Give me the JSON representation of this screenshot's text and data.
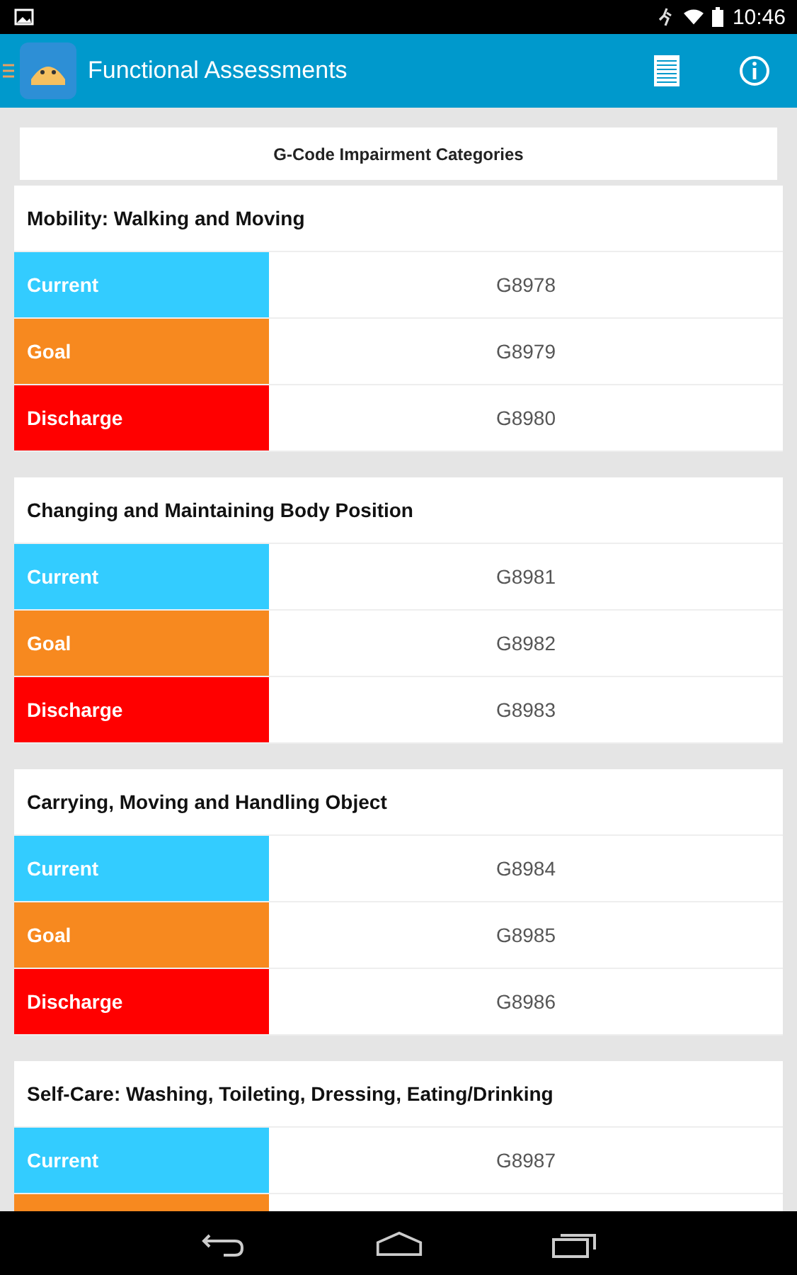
{
  "status_bar": {
    "time": "10:46"
  },
  "app_bar": {
    "title": "Functional Assessments"
  },
  "header": {
    "title": "G-Code Impairment Categories"
  },
  "categories": [
    {
      "title": "Mobility: Walking and Moving",
      "rows": [
        {
          "kind": "current",
          "label": "Current",
          "code": "G8978"
        },
        {
          "kind": "goal",
          "label": "Goal",
          "code": "G8979"
        },
        {
          "kind": "discharge",
          "label": "Discharge",
          "code": "G8980"
        }
      ]
    },
    {
      "title": "Changing and Maintaining Body Position",
      "rows": [
        {
          "kind": "current",
          "label": "Current",
          "code": "G8981"
        },
        {
          "kind": "goal",
          "label": "Goal",
          "code": "G8982"
        },
        {
          "kind": "discharge",
          "label": "Discharge",
          "code": "G8983"
        }
      ]
    },
    {
      "title": "Carrying, Moving and Handling Object",
      "rows": [
        {
          "kind": "current",
          "label": "Current",
          "code": "G8984"
        },
        {
          "kind": "goal",
          "label": "Goal",
          "code": "G8985"
        },
        {
          "kind": "discharge",
          "label": "Discharge",
          "code": "G8986"
        }
      ]
    },
    {
      "title": "Self-Care: Washing, Toileting, Dressing, Eating/Drinking",
      "rows": [
        {
          "kind": "current",
          "label": "Current",
          "code": "G8987"
        },
        {
          "kind": "goal"
        }
      ]
    }
  ]
}
